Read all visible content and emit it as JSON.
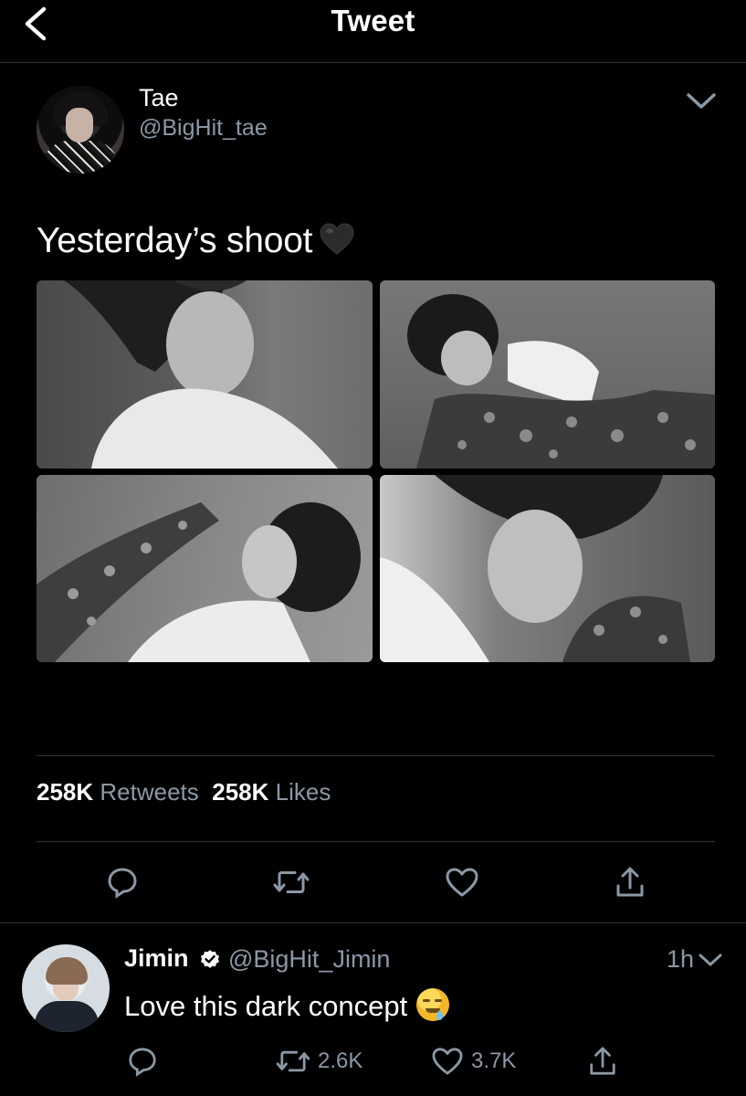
{
  "header": {
    "title": "Tweet",
    "back_icon": "chevron-left-icon"
  },
  "tweet": {
    "author_name": "Tae",
    "author_handle": "@BigHit_tae",
    "text": "Yesterday’s shoot",
    "emoji": "black-heart",
    "media_count": 4,
    "retweets_count": "258K",
    "retweets_label": "Retweets",
    "likes_count": "258K",
    "likes_label": "Likes",
    "actions": [
      "reply-icon",
      "retweet-icon",
      "like-icon",
      "share-icon"
    ]
  },
  "reply": {
    "author_name": "Jimin",
    "verified": true,
    "author_handle": "@BigHit_Jimin",
    "time": "1h",
    "text": "Love this dark concept",
    "emoji": "drooling-face",
    "retweets": "2.6K",
    "likes": "3.7K"
  },
  "colors": {
    "background": "#000000",
    "text": "#ffffff",
    "secondary_text": "#8b98a5",
    "divider": "#2f3336"
  }
}
